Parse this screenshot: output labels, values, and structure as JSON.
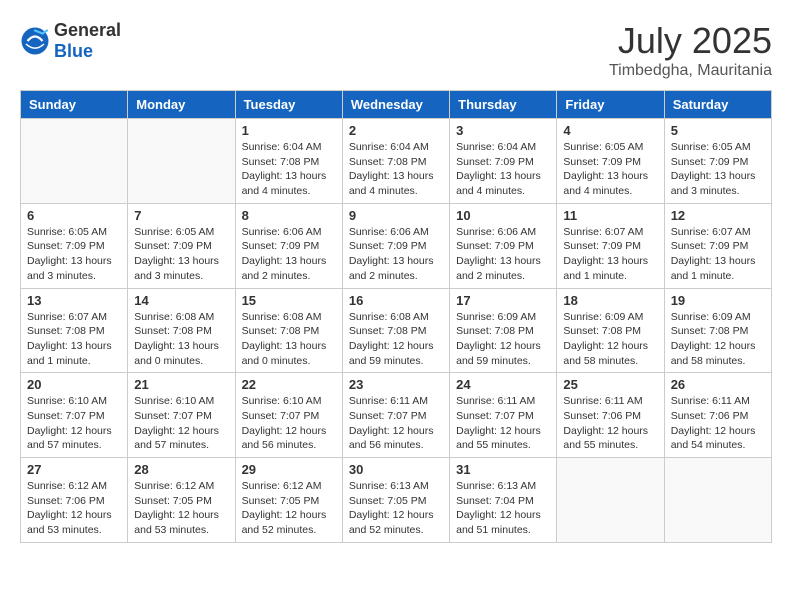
{
  "header": {
    "logo": {
      "general": "General",
      "blue": "Blue"
    },
    "month": "July 2025",
    "location": "Timbedgha, Mauritania"
  },
  "weekdays": [
    "Sunday",
    "Monday",
    "Tuesday",
    "Wednesday",
    "Thursday",
    "Friday",
    "Saturday"
  ],
  "weeks": [
    [
      {
        "day": "",
        "info": ""
      },
      {
        "day": "",
        "info": ""
      },
      {
        "day": "1",
        "info": "Sunrise: 6:04 AM\nSunset: 7:08 PM\nDaylight: 13 hours and 4 minutes."
      },
      {
        "day": "2",
        "info": "Sunrise: 6:04 AM\nSunset: 7:08 PM\nDaylight: 13 hours and 4 minutes."
      },
      {
        "day": "3",
        "info": "Sunrise: 6:04 AM\nSunset: 7:09 PM\nDaylight: 13 hours and 4 minutes."
      },
      {
        "day": "4",
        "info": "Sunrise: 6:05 AM\nSunset: 7:09 PM\nDaylight: 13 hours and 4 minutes."
      },
      {
        "day": "5",
        "info": "Sunrise: 6:05 AM\nSunset: 7:09 PM\nDaylight: 13 hours and 3 minutes."
      }
    ],
    [
      {
        "day": "6",
        "info": "Sunrise: 6:05 AM\nSunset: 7:09 PM\nDaylight: 13 hours and 3 minutes."
      },
      {
        "day": "7",
        "info": "Sunrise: 6:05 AM\nSunset: 7:09 PM\nDaylight: 13 hours and 3 minutes."
      },
      {
        "day": "8",
        "info": "Sunrise: 6:06 AM\nSunset: 7:09 PM\nDaylight: 13 hours and 2 minutes."
      },
      {
        "day": "9",
        "info": "Sunrise: 6:06 AM\nSunset: 7:09 PM\nDaylight: 13 hours and 2 minutes."
      },
      {
        "day": "10",
        "info": "Sunrise: 6:06 AM\nSunset: 7:09 PM\nDaylight: 13 hours and 2 minutes."
      },
      {
        "day": "11",
        "info": "Sunrise: 6:07 AM\nSunset: 7:09 PM\nDaylight: 13 hours and 1 minute."
      },
      {
        "day": "12",
        "info": "Sunrise: 6:07 AM\nSunset: 7:09 PM\nDaylight: 13 hours and 1 minute."
      }
    ],
    [
      {
        "day": "13",
        "info": "Sunrise: 6:07 AM\nSunset: 7:08 PM\nDaylight: 13 hours and 1 minute."
      },
      {
        "day": "14",
        "info": "Sunrise: 6:08 AM\nSunset: 7:08 PM\nDaylight: 13 hours and 0 minutes."
      },
      {
        "day": "15",
        "info": "Sunrise: 6:08 AM\nSunset: 7:08 PM\nDaylight: 13 hours and 0 minutes."
      },
      {
        "day": "16",
        "info": "Sunrise: 6:08 AM\nSunset: 7:08 PM\nDaylight: 12 hours and 59 minutes."
      },
      {
        "day": "17",
        "info": "Sunrise: 6:09 AM\nSunset: 7:08 PM\nDaylight: 12 hours and 59 minutes."
      },
      {
        "day": "18",
        "info": "Sunrise: 6:09 AM\nSunset: 7:08 PM\nDaylight: 12 hours and 58 minutes."
      },
      {
        "day": "19",
        "info": "Sunrise: 6:09 AM\nSunset: 7:08 PM\nDaylight: 12 hours and 58 minutes."
      }
    ],
    [
      {
        "day": "20",
        "info": "Sunrise: 6:10 AM\nSunset: 7:07 PM\nDaylight: 12 hours and 57 minutes."
      },
      {
        "day": "21",
        "info": "Sunrise: 6:10 AM\nSunset: 7:07 PM\nDaylight: 12 hours and 57 minutes."
      },
      {
        "day": "22",
        "info": "Sunrise: 6:10 AM\nSunset: 7:07 PM\nDaylight: 12 hours and 56 minutes."
      },
      {
        "day": "23",
        "info": "Sunrise: 6:11 AM\nSunset: 7:07 PM\nDaylight: 12 hours and 56 minutes."
      },
      {
        "day": "24",
        "info": "Sunrise: 6:11 AM\nSunset: 7:07 PM\nDaylight: 12 hours and 55 minutes."
      },
      {
        "day": "25",
        "info": "Sunrise: 6:11 AM\nSunset: 7:06 PM\nDaylight: 12 hours and 55 minutes."
      },
      {
        "day": "26",
        "info": "Sunrise: 6:11 AM\nSunset: 7:06 PM\nDaylight: 12 hours and 54 minutes."
      }
    ],
    [
      {
        "day": "27",
        "info": "Sunrise: 6:12 AM\nSunset: 7:06 PM\nDaylight: 12 hours and 53 minutes."
      },
      {
        "day": "28",
        "info": "Sunrise: 6:12 AM\nSunset: 7:05 PM\nDaylight: 12 hours and 53 minutes."
      },
      {
        "day": "29",
        "info": "Sunrise: 6:12 AM\nSunset: 7:05 PM\nDaylight: 12 hours and 52 minutes."
      },
      {
        "day": "30",
        "info": "Sunrise: 6:13 AM\nSunset: 7:05 PM\nDaylight: 12 hours and 52 minutes."
      },
      {
        "day": "31",
        "info": "Sunrise: 6:13 AM\nSunset: 7:04 PM\nDaylight: 12 hours and 51 minutes."
      },
      {
        "day": "",
        "info": ""
      },
      {
        "day": "",
        "info": ""
      }
    ]
  ]
}
